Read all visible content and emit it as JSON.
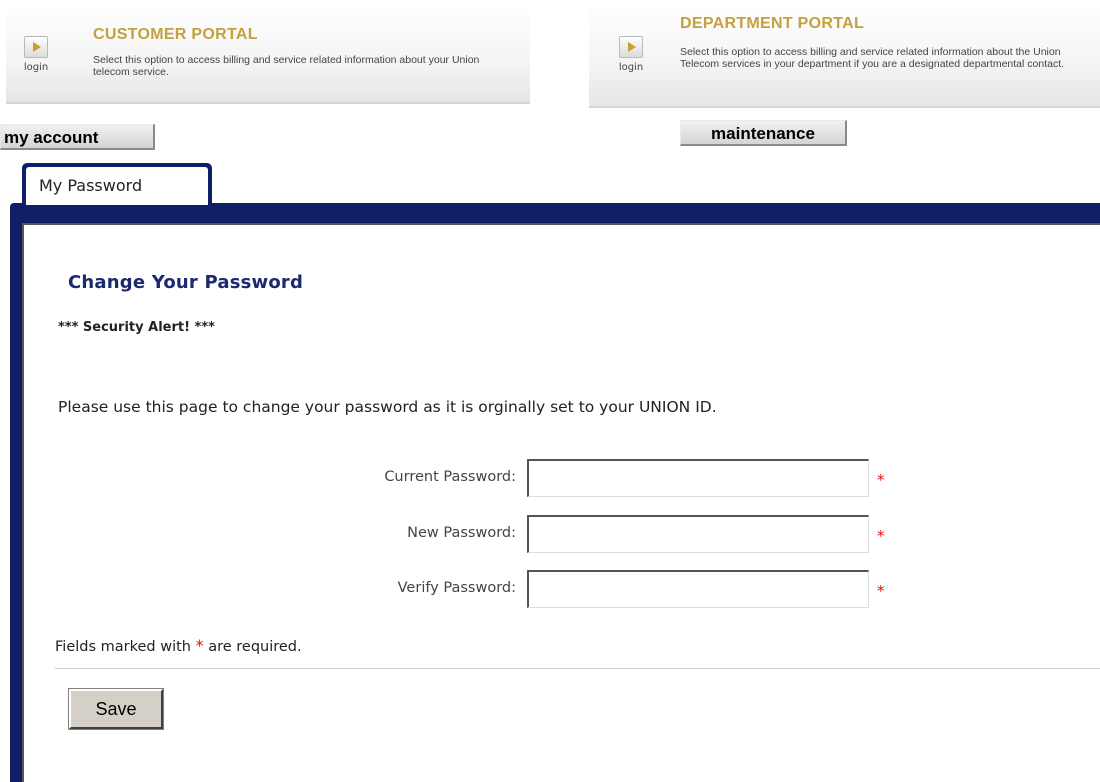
{
  "customer_portal": {
    "title": "CUSTOMER PORTAL",
    "description": "Select this option to access billing and service related information about your Union telecom service.",
    "login_label": "login"
  },
  "department_portal": {
    "title": "DEPARTMENT PORTAL",
    "description": "Select this option to access billing and service related information about the Union Telecom services in your department if you are a designated departmental contact.",
    "login_label": "login"
  },
  "nav": {
    "my_account": "my account",
    "maintenance": "maintenance"
  },
  "tabs": [
    {
      "label": "My Password"
    }
  ],
  "form": {
    "heading": "Change Your Password",
    "alert": "*** Security Alert! ***",
    "instructions": "Please use this page to change your password as it is orginally set to your UNION ID.",
    "fields": [
      {
        "label": "Current Password:",
        "value": "",
        "required_marker": "*"
      },
      {
        "label": "New Password:",
        "value": "",
        "required_marker": "*"
      },
      {
        "label": "Verify Password:",
        "value": "",
        "required_marker": "*"
      }
    ],
    "required_note_before": "Fields marked with ",
    "required_note_marker": "*",
    "required_note_after": " are required.",
    "save_label": "Save"
  },
  "colors": {
    "portal_title": "#c4a13d",
    "tab_border": "#0f1f66",
    "heading": "#1a2a6c",
    "required": "#dd1111"
  },
  "icons": {
    "login": "play-arrow-icon"
  }
}
